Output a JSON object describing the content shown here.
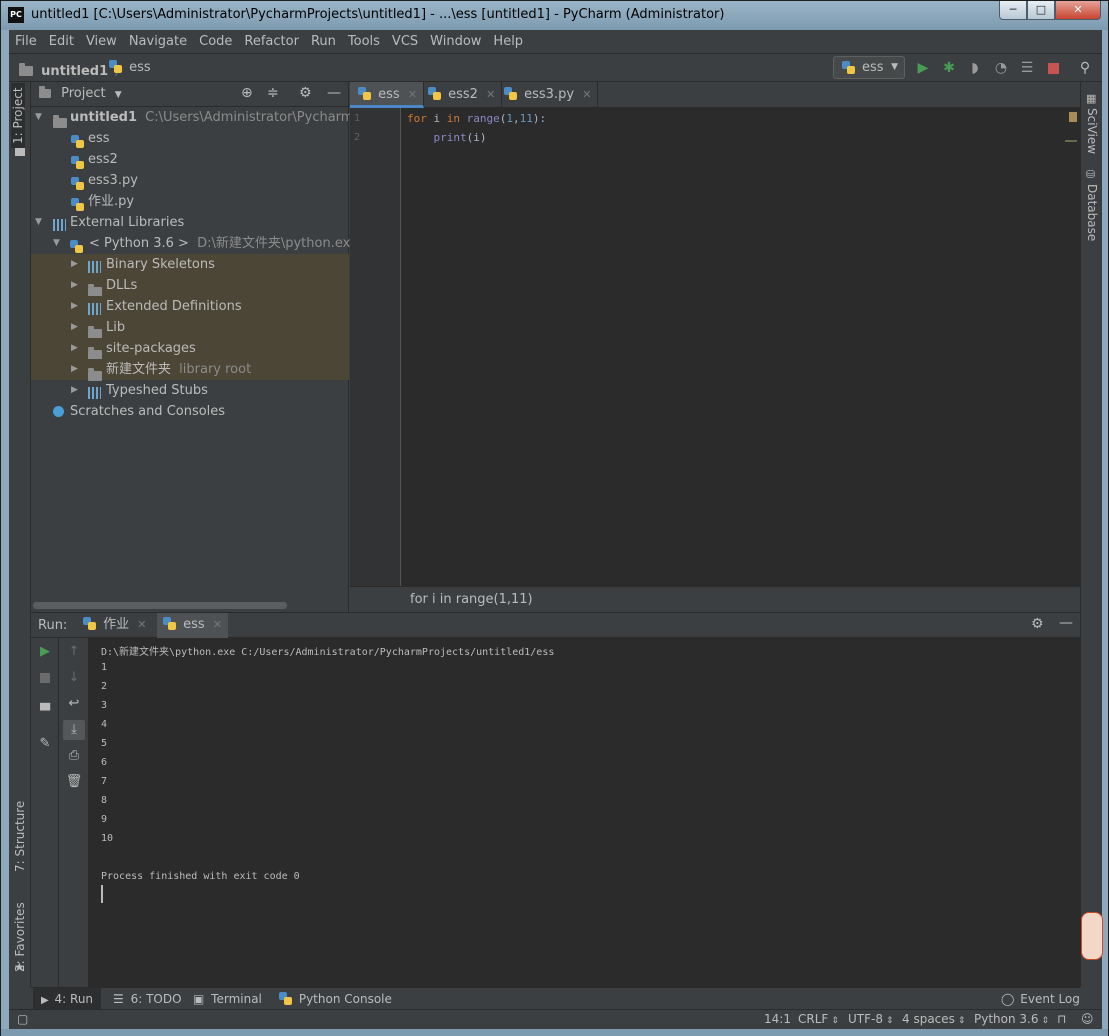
{
  "window": {
    "title": "untitled1 [C:\\Users\\Administrator\\PycharmProjects\\untitled1] - ...\\ess [untitled1] - PyCharm (Administrator)",
    "app_icon": "PC",
    "min": "─",
    "max": "□",
    "close": "✕"
  },
  "menu": [
    "File",
    "Edit",
    "View",
    "Navigate",
    "Code",
    "Refactor",
    "Run",
    "Tools",
    "VCS",
    "Window",
    "Help"
  ],
  "navbar": {
    "project": "untitled1",
    "file": "ess",
    "run_config": "ess"
  },
  "left_stripe": {
    "project": "1: Project",
    "structure": "7: Structure",
    "favorites": "2: Favorites"
  },
  "right_stripe": {
    "sciview": "SciView",
    "database": "Database"
  },
  "project_panel": {
    "title": "Project",
    "root": "untitled1",
    "root_path": "C:\\Users\\Administrator\\PycharmProje",
    "files": [
      "ess",
      "ess2",
      "ess3.py",
      "作业.py"
    ],
    "external": "External Libraries",
    "sdk": "< Python 3.6 >",
    "sdk_path": "D:\\新建文件夹\\python.exe",
    "lib_items": [
      "Binary Skeletons",
      "DLLs",
      "Extended Definitions",
      "Lib",
      "site-packages",
      "新建文件夹"
    ],
    "lib_root_hint": "library root",
    "typeshed": "Typeshed Stubs",
    "scratches": "Scratches and Consoles"
  },
  "editor": {
    "tabs": [
      "ess",
      "ess2",
      "ess3.py"
    ],
    "line_numbers": [
      "1",
      "2"
    ],
    "code": {
      "l1_kw1": "for",
      "l1_var": " i ",
      "l1_kw2": "in",
      "l1_fn": " range",
      "l1_open": "(",
      "l1_n1": "1",
      "l1_comma": ",",
      "l1_n2": "11",
      "l1_close": "):",
      "l2_fn": "print",
      "l2_rest": "(i)"
    },
    "breadcrumb": "for i in range(1,11)"
  },
  "run_panel": {
    "label": "Run:",
    "tabs": [
      "作业",
      "ess"
    ],
    "command": "D:\\新建文件夹\\python.exe C:/Users/Administrator/PycharmProjects/untitled1/ess",
    "output": [
      "1",
      "2",
      "3",
      "4",
      "5",
      "6",
      "7",
      "8",
      "9",
      "10"
    ],
    "finished": "Process finished with exit code 0"
  },
  "bottom_bar": {
    "run": "4: Run",
    "todo": "6: TODO",
    "terminal": "Terminal",
    "python_console": "Python Console",
    "event_log": "Event Log"
  },
  "status_bar": {
    "position": "14:1",
    "line_sep": "CRLF",
    "encoding": "UTF-8",
    "indent": "4 spaces",
    "interpreter": "Python 3.6"
  },
  "colors": {
    "accent": "#4a88c7",
    "run_green": "#499c54",
    "stop_red": "#c75450",
    "keyword": "#cc7832",
    "number": "#6897bb"
  }
}
